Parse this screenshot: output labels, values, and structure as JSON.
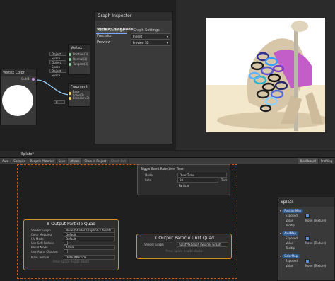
{
  "shader_graph": {
    "vertex_title": "Vertex",
    "fragment_title": "Fragment",
    "vertex_slots": [
      {
        "space": "Object Space",
        "port": "Position(3)"
      },
      {
        "space": "Object Space",
        "port": "Normal(3)"
      },
      {
        "space": "Object Space",
        "port": "Tangent(3)"
      }
    ],
    "fragment_slots": [
      {
        "space": "",
        "port": "Base Color(3)"
      },
      {
        "space": "0",
        "port": "Emission(3)"
      }
    ],
    "color_node": {
      "title": "Vertex Color",
      "port": "Out(4)"
    }
  },
  "inspector": {
    "title": "Graph Inspector",
    "tabs": [
      "Node Settings",
      "Graph Settings"
    ],
    "section": "Vertex Color Node",
    "precision_label": "Precision",
    "precision_value": "Inherit",
    "preview_label": "Preview",
    "preview_value": "Preview 3D"
  },
  "vfx": {
    "tab": "Splats*",
    "toolbar": [
      "Auto",
      "Compile",
      "Recycle Material",
      "Save",
      "Attach",
      "Show in Project",
      "Check Out",
      "Blackboard",
      "Profiling"
    ],
    "toolbar_active": [
      "Attach",
      "Blackboard"
    ],
    "event_node": {
      "title": "Trigger Event Rate (Over Time)",
      "mode_label": "Mode",
      "mode_value": "Over Time",
      "rate_label": "Rate",
      "rate_value": "60",
      "rate_field": "Text",
      "out_label": "Particle"
    },
    "quad": {
      "title": "Output Particle Quad",
      "rows": [
        {
          "k": "Shader Graph",
          "v": "None (Shader Graph VFX Asset)"
        },
        {
          "k": "Color Mapping",
          "v": "Default"
        },
        {
          "k": "UV Mode",
          "v": "Default"
        },
        {
          "k": "Use Soft Particle",
          "v": ""
        },
        {
          "k": "Blend Mode",
          "v": "Alpha"
        },
        {
          "k": "Use Alpha Clipping",
          "v": ""
        },
        {
          "k": "Main Texture",
          "v": "DefaultParticle"
        }
      ],
      "footer": "Press Space to add blocks"
    },
    "unlit": {
      "title": "Output Particle Unlit Quad",
      "rows": [
        {
          "k": "Shader Graph",
          "v": "SplatVfxGraph (Shader Graph VFX)"
        }
      ],
      "footer": "Press Space to add blocks"
    }
  },
  "blackboard": {
    "title": "Splats",
    "items": [
      {
        "name": "PositionMap",
        "exposed": "Exposed",
        "value_label": "Value",
        "value": "None (Texture)",
        "tooltip": "Tooltip"
      },
      {
        "name": "AxisMap",
        "exposed": "Exposed",
        "value_label": "Value",
        "value": "None (Texture)",
        "tooltip": "Tooltip"
      },
      {
        "name": "ColorMap",
        "exposed": "Exposed",
        "value_label": "Value",
        "value": "None (Texture)",
        "tooltip": "Tooltip"
      }
    ]
  },
  "colors": {
    "accent": "#d7911e",
    "dash": "#c75b1b",
    "exposed": "#2f5a8c"
  }
}
